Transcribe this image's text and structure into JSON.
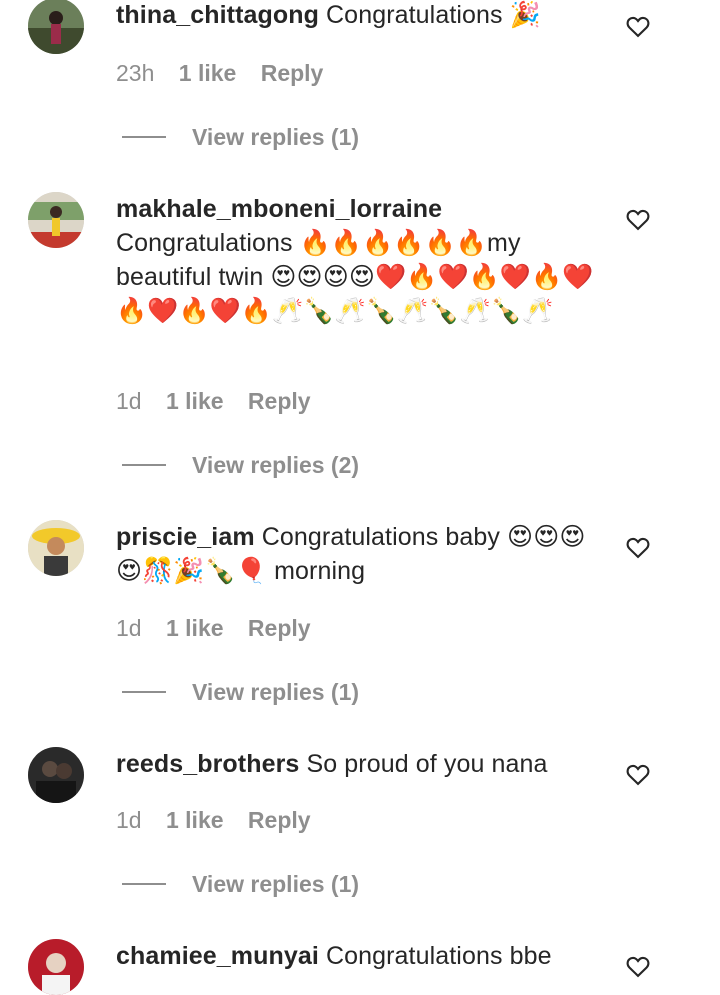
{
  "comments": [
    {
      "username": "thina_chittagong",
      "text": "Congratulations 🎉",
      "time": "23h",
      "likes": "1 like",
      "reply": "Reply",
      "view_replies": "View replies (1)"
    },
    {
      "username": "makhale_mboneni_lorraine",
      "text": "Congratulations 🔥🔥🔥🔥🔥🔥my beautiful twin 😍😍😍😍❤️🔥❤️🔥❤️🔥❤️🔥❤️🔥❤️🔥🥂🍾🥂🍾🥂🍾🥂🍾🥂",
      "time": "1d",
      "likes": "1 like",
      "reply": "Reply",
      "view_replies": "View replies (2)"
    },
    {
      "username": "priscie_iam",
      "text": "Congratulations baby 😍😍😍😍🎊🎉🍾🎈 morning",
      "time": "1d",
      "likes": "1 like",
      "reply": "Reply",
      "view_replies": "View replies (1)"
    },
    {
      "username": "reeds_brothers",
      "text": "So proud of you nana",
      "time": "1d",
      "likes": "1 like",
      "reply": "Reply",
      "view_replies": "View replies (1)"
    },
    {
      "username": "chamiee_munyai",
      "text": "Congratulations bbe"
    }
  ],
  "icons": {
    "like": "heart-outline-icon"
  },
  "colors": {
    "text": "#262626",
    "meta": "#8e8e8e"
  }
}
